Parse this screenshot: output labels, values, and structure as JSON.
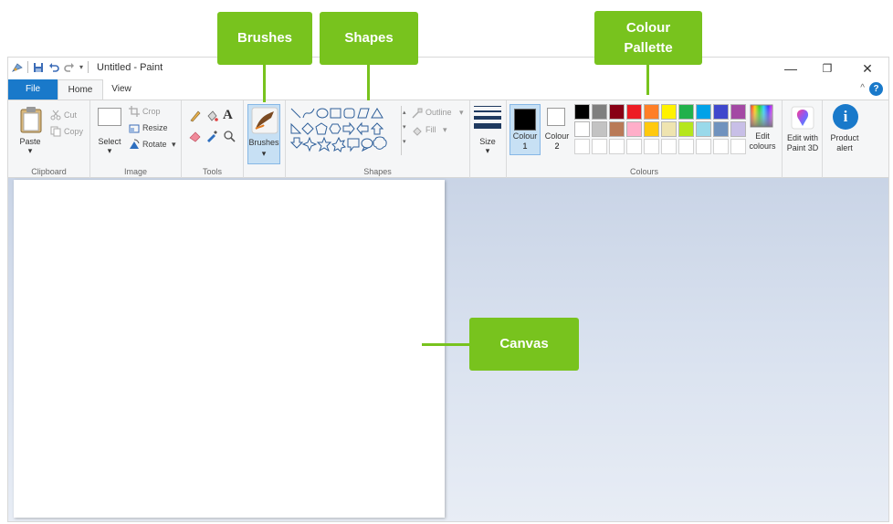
{
  "window": {
    "title": "Untitled - Paint",
    "minimize": "—",
    "maximize": "❐",
    "close": "✕"
  },
  "tabs": [
    {
      "label": "File"
    },
    {
      "label": "Home"
    },
    {
      "label": "View"
    }
  ],
  "ribbon": {
    "clipboard": {
      "label": "Clipboard",
      "paste": "Paste",
      "cut": "Cut",
      "copy": "Copy"
    },
    "image": {
      "label": "Image",
      "select": "Select",
      "crop": "Crop",
      "resize": "Resize",
      "rotate": "Rotate"
    },
    "tools": {
      "label": "Tools"
    },
    "brushes": {
      "label": "Brushes"
    },
    "shapes": {
      "label": "Shapes",
      "outline": "Outline",
      "fill": "Fill"
    },
    "size": {
      "label": "Size"
    },
    "colours": {
      "label": "Colours",
      "colour1": "Colour 1",
      "colour1_num": "1",
      "colour2": "Colour 2",
      "colour2_num": "2",
      "edit": "Edit colours"
    },
    "paint3d": {
      "line1": "Edit with",
      "line2": "Paint 3D"
    },
    "product_alert": {
      "line1": "Product",
      "line2": "alert"
    }
  },
  "palette": {
    "row1": [
      "#000000",
      "#7f7f7f",
      "#880015",
      "#ed1c24",
      "#ff7f27",
      "#fff200",
      "#22b14c",
      "#00a2e8",
      "#3f48cc",
      "#a349a4"
    ],
    "row2": [
      "#ffffff",
      "#c3c3c3",
      "#b97a57",
      "#ffaec9",
      "#ffc90e",
      "#efe4b0",
      "#b5e61d",
      "#99d9ea",
      "#7092be",
      "#c8bfe7"
    ]
  },
  "callouts": {
    "brushes": "Brushes",
    "shapes": "Shapes",
    "palette_line1": "Colour",
    "palette_line2": "Pallette",
    "canvas": "Canvas"
  },
  "colors": {
    "accent_green": "#78c31e",
    "file_tab_blue": "#1979ca",
    "workspace_blue": "#c9d4e6"
  }
}
